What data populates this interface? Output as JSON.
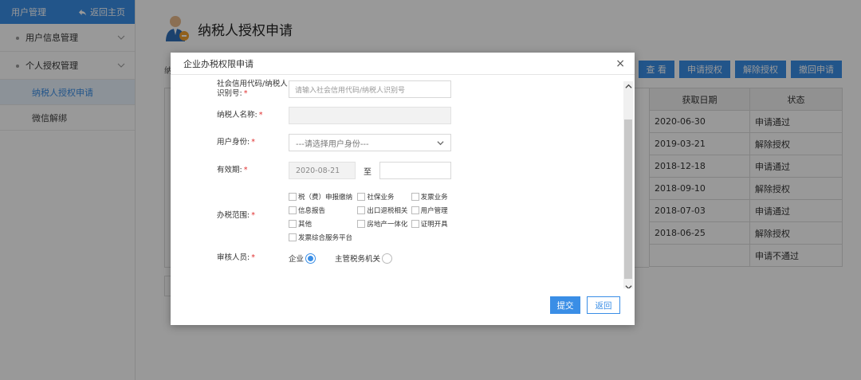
{
  "sidebar": {
    "header_title": "用户管理",
    "home_label": "返回主页",
    "items": [
      {
        "label": "用户信息管理"
      },
      {
        "label": "个人授权管理"
      }
    ],
    "subitems": [
      {
        "label": "纳税人授权申请",
        "active": true
      },
      {
        "label": "微信解绑",
        "active": false
      }
    ]
  },
  "main": {
    "title": "纳税人授权申请",
    "cut_label": "纳",
    "toolbar": [
      "查 看",
      "申请授权",
      "解除授权",
      "撤回申请"
    ],
    "table": {
      "headers": [
        "获取日期",
        "状态"
      ],
      "rows": [
        [
          "2020-06-30",
          "申请通过"
        ],
        [
          "2019-03-21",
          "解除授权"
        ],
        [
          "2018-12-18",
          "申请通过"
        ],
        [
          "2018-09-10",
          "解除授权"
        ],
        [
          "2018-07-03",
          "申请通过"
        ],
        [
          "2018-06-25",
          "解除授权"
        ],
        [
          "",
          "申请不通过"
        ]
      ]
    }
  },
  "modal": {
    "title": "企业办税权限申请",
    "close": "×",
    "fields": {
      "credit_code_label": "社会信用代码/纳税人识别号:",
      "credit_code_placeholder": "请输入社会信用代码/纳税人识别号",
      "name_label": "纳税人名称:",
      "identity_label": "用户身份:",
      "identity_value": "---请选择用户身份---",
      "validity_label": "有效期:",
      "validity_start": "2020-08-21",
      "validity_to": "至",
      "scope_label": "办税范围:",
      "scope_options": [
        [
          "税（费）申报缴纳",
          "社保业务",
          "发票业务"
        ],
        [
          "信息报告",
          "出口退税相关",
          "用户管理"
        ],
        [
          "其他",
          "房地产一体化",
          "证明开具"
        ],
        [
          "发票综合服务平台"
        ]
      ],
      "reviewer_label": "审核人员:",
      "reviewer_options": [
        {
          "label": "企业",
          "checked": true
        },
        {
          "label": "主管税务机关",
          "checked": false
        }
      ]
    },
    "submit": "提交",
    "back": "返回"
  },
  "colors": {
    "accent": "#3a8ee6",
    "required": "#e03030"
  }
}
